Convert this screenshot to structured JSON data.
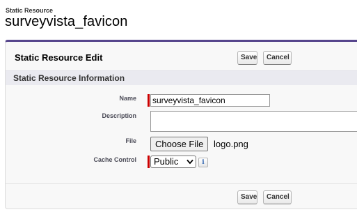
{
  "page": {
    "type_label": "Static Resource",
    "title": "surveyvista_favicon"
  },
  "panel": {
    "title": "Static Resource Edit",
    "save_label": "Save",
    "cancel_label": "Cancel"
  },
  "section": {
    "title": "Static Resource Information"
  },
  "fields": {
    "name_label": "Name",
    "name_value": "surveyvista_favicon",
    "description_label": "Description",
    "description_value": "",
    "file_label": "File",
    "file_button": "Choose File",
    "file_name": "logo.png",
    "cache_label": "Cache Control",
    "cache_value": "Public",
    "info_glyph": "i"
  },
  "colors": {
    "accent_border": "#56458c",
    "required_bar": "#cc0000"
  },
  "icons": [
    "chevron-down-icon",
    "info-icon"
  ]
}
